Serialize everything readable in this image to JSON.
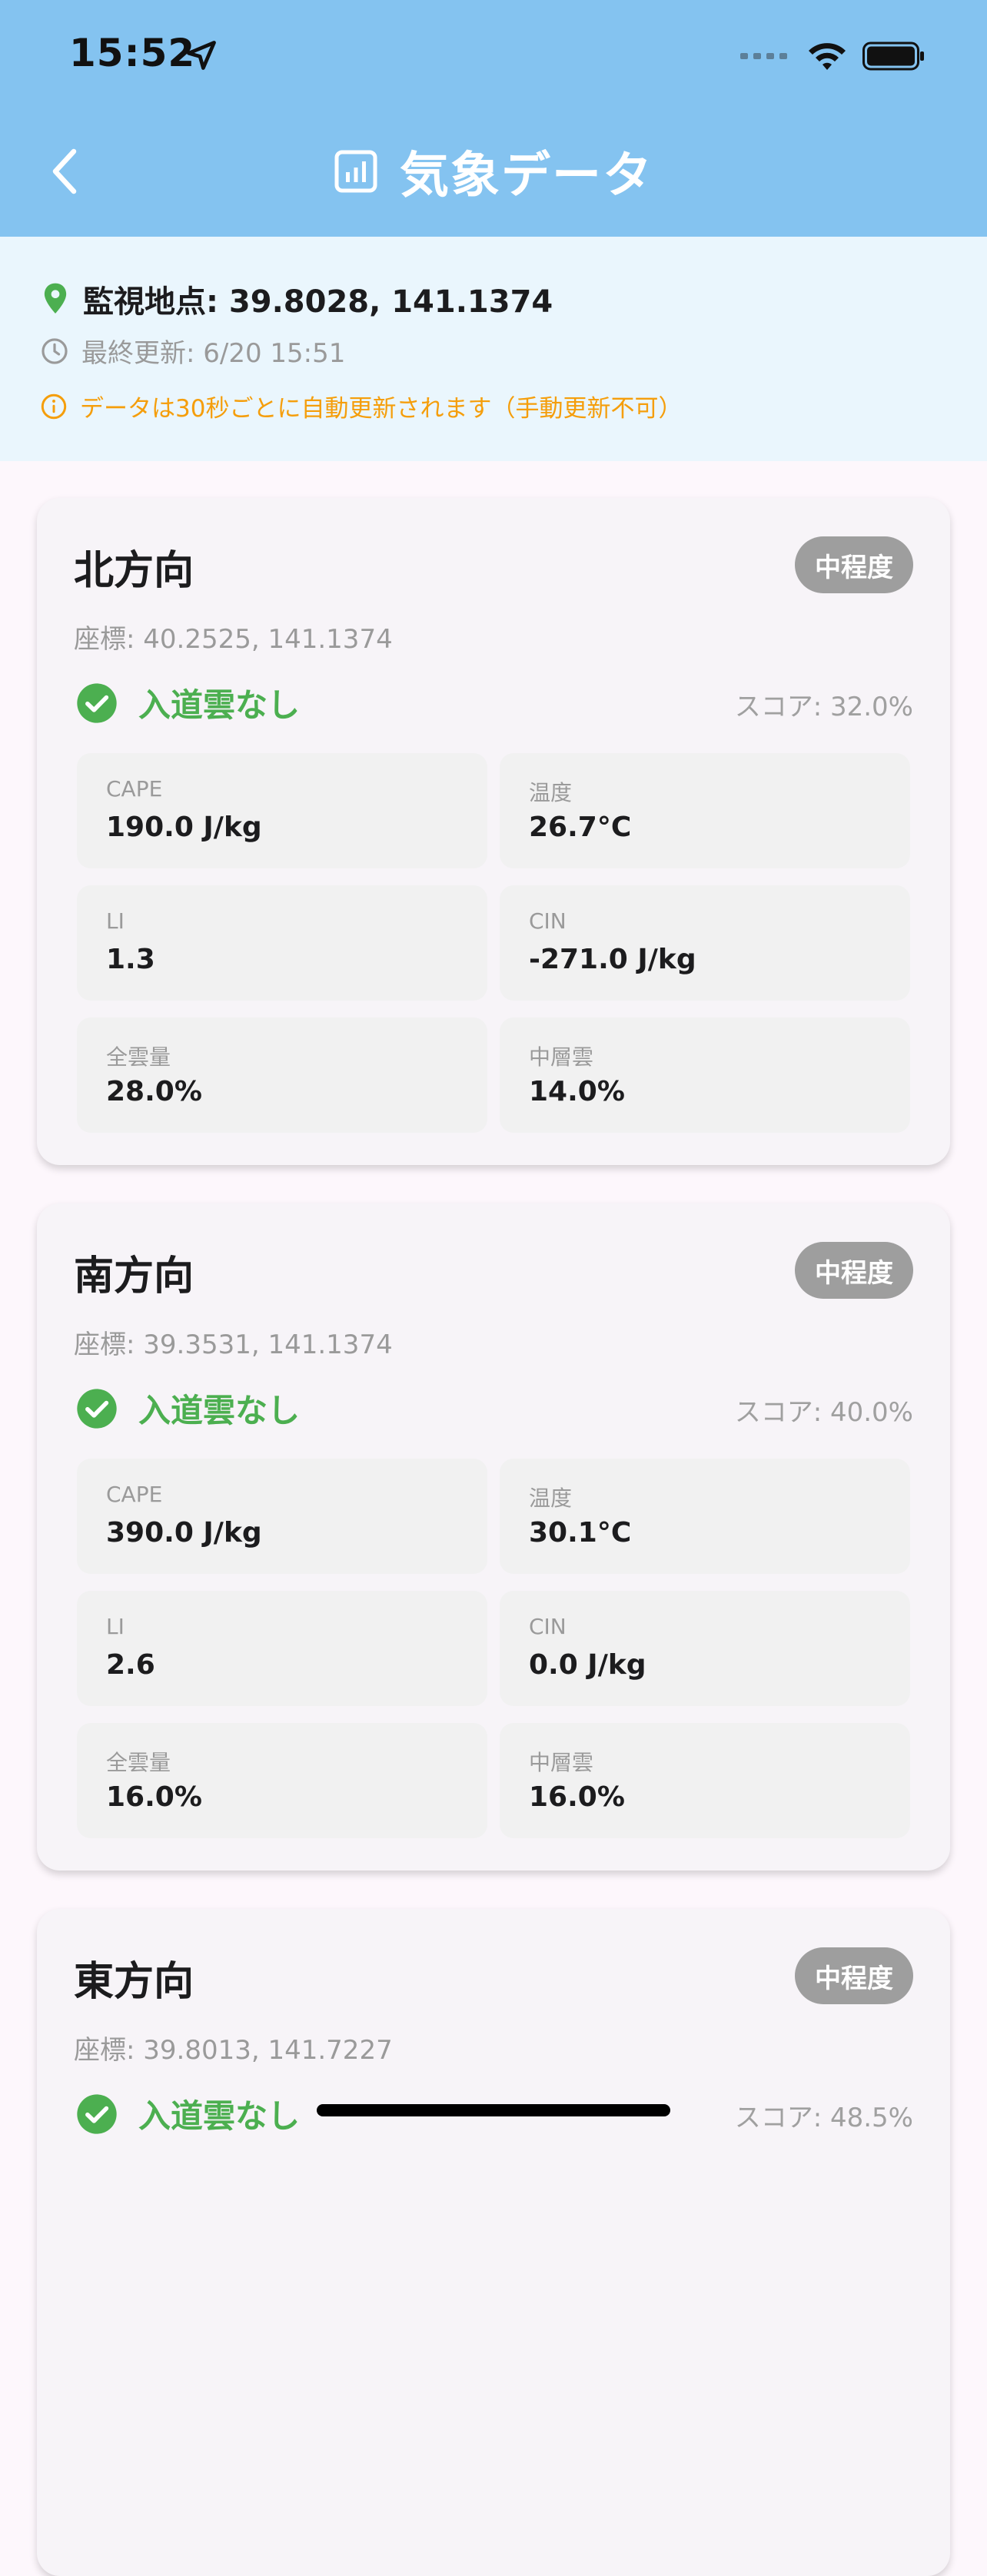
{
  "status_bar": {
    "time": "15:52"
  },
  "header": {
    "title": "気象データ",
    "icon": "bar-chart-icon",
    "background": "#84c3f0"
  },
  "info": {
    "location": "監視地点: 39.8028, 141.1374",
    "updated": "最終更新: 6/20 15:51",
    "note": "データは30秒ごとに自動更新されます（手動更新不可）"
  },
  "cards": [
    {
      "title": "北方向",
      "badge": "中程度",
      "coords": "座標: 40.2525, 141.1374",
      "status": "入道雲なし",
      "score": "スコア: 32.0%",
      "metrics": [
        {
          "label": "CAPE",
          "value": "190.0 J/kg"
        },
        {
          "label": "温度",
          "value": "26.7°C"
        },
        {
          "label": "LI",
          "value": "1.3"
        },
        {
          "label": "CIN",
          "value": "-271.0 J/kg"
        },
        {
          "label": "全雲量",
          "value": "28.0%"
        },
        {
          "label": "中層雲",
          "value": "14.0%"
        }
      ]
    },
    {
      "title": "南方向",
      "badge": "中程度",
      "coords": "座標: 39.3531, 141.1374",
      "status": "入道雲なし",
      "score": "スコア: 40.0%",
      "metrics": [
        {
          "label": "CAPE",
          "value": "390.0 J/kg"
        },
        {
          "label": "温度",
          "value": "30.1°C"
        },
        {
          "label": "LI",
          "value": "2.6"
        },
        {
          "label": "CIN",
          "value": "0.0 J/kg"
        },
        {
          "label": "全雲量",
          "value": "16.0%"
        },
        {
          "label": "中層雲",
          "value": "16.0%"
        }
      ]
    },
    {
      "title": "東方向",
      "badge": "中程度",
      "coords": "座標: 39.8013, 141.7227",
      "status": "入道雲なし",
      "score": "スコア: 48.5%"
    }
  ]
}
